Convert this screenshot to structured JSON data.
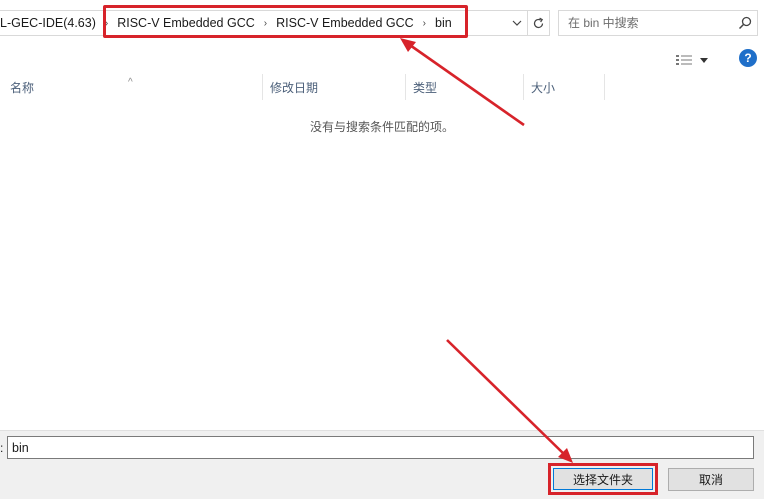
{
  "address_bar": {
    "path": [
      "L-GEC-IDE(4.63)",
      "RISC-V Embedded GCC",
      "RISC-V Embedded GCC",
      "bin"
    ],
    "search_placeholder": "在 bin 中搜索"
  },
  "toolbar": {
    "help_label": "?"
  },
  "columns": {
    "name": "名称",
    "date": "修改日期",
    "type": "类型",
    "size": "大小"
  },
  "file_list": {
    "empty_message": "没有与搜索条件匹配的项。"
  },
  "footer": {
    "folder_label": ":",
    "folder_value": "bin",
    "select_button": "选择文件夹",
    "cancel_button": "取消"
  },
  "colors": {
    "annotation_red": "#d7232a",
    "accent_blue": "#0078d7",
    "help_blue": "#1f6fc9",
    "header_text": "#4c607a"
  }
}
